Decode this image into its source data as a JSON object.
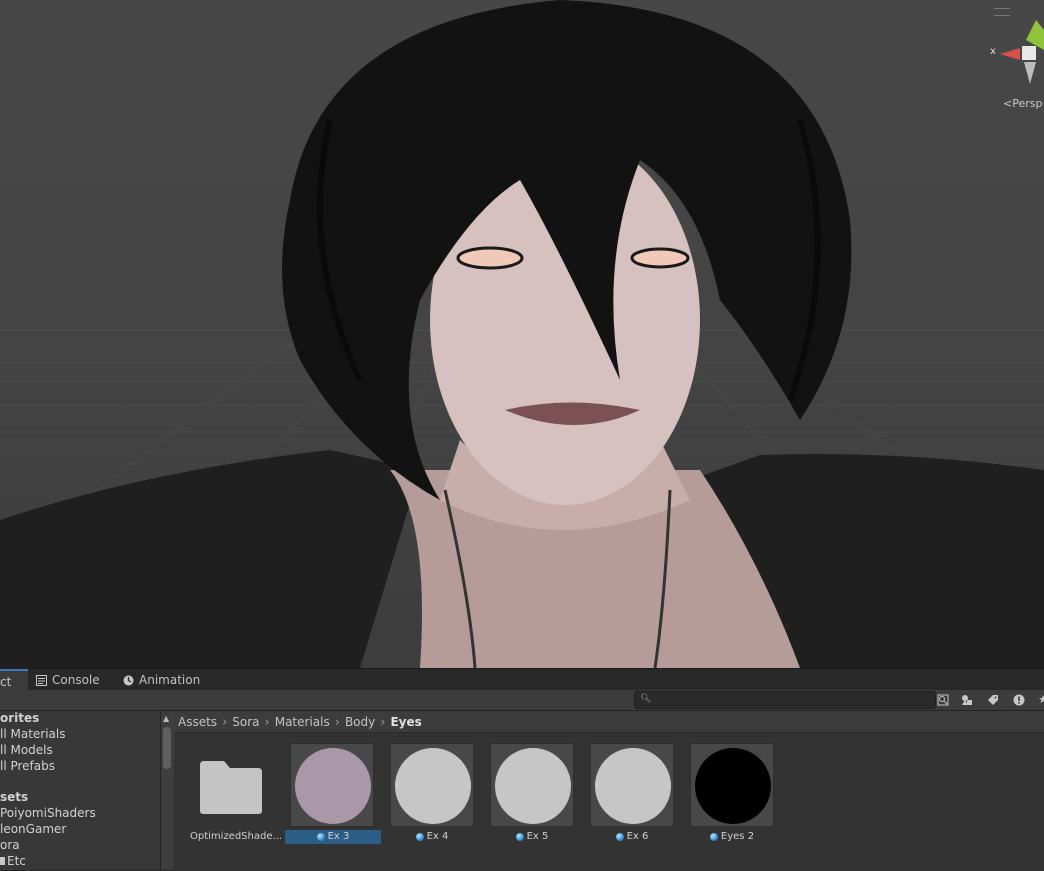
{
  "scene": {
    "axis_label": "x",
    "projection_label": "Persp",
    "character_description_icon": "avatar-render"
  },
  "tabs": [
    {
      "label": "Project",
      "visible_label": "ct",
      "icon": "project-icon",
      "active": true
    },
    {
      "label": "Console",
      "icon": "console-icon",
      "active": false
    },
    {
      "label": "Animation",
      "icon": "animation-icon",
      "active": false
    }
  ],
  "toolbar": {
    "search_placeholder": "",
    "buttons": [
      "search-by-type-icon",
      "filter-icon",
      "label-icon",
      "info-icon",
      "star-icon"
    ]
  },
  "sidebar": {
    "favorites_header": "orites",
    "favorites": [
      "ll Materials",
      "ll Models",
      "ll Prefabs"
    ],
    "assets_header": "sets",
    "folders": [
      "PoiyomiShaders",
      "leonGamer",
      "ora",
      "Etc"
    ]
  },
  "breadcrumb": [
    "Assets",
    "Sora",
    "Materials",
    "Body",
    "Eyes"
  ],
  "assets": [
    {
      "name": "OptimizedShade...",
      "type": "folder",
      "selected": false
    },
    {
      "name": "Ex 3",
      "type": "material",
      "color": "#a898a8",
      "selected": true
    },
    {
      "name": "Ex 4",
      "type": "material",
      "color": "#c6c6c6",
      "selected": false
    },
    {
      "name": "Ex 5",
      "type": "material",
      "color": "#c6c6c6",
      "selected": false
    },
    {
      "name": "Ex 6",
      "type": "material",
      "color": "#c6c6c6",
      "selected": false
    },
    {
      "name": "Eyes 2",
      "type": "material",
      "color": "#000000",
      "selected": false
    }
  ],
  "colors": {
    "accent": "#3a79bb",
    "selection": "#2c5d87",
    "panel": "#3c3c3c"
  }
}
